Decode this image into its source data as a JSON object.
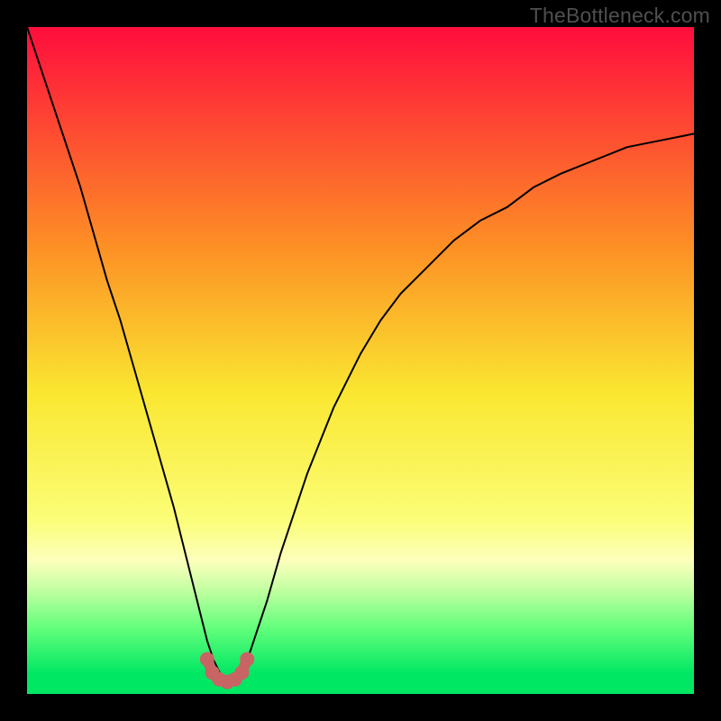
{
  "watermark": "TheBottleneck.com",
  "chart_data": {
    "type": "line",
    "title": "",
    "xlabel": "",
    "ylabel": "",
    "xlim": [
      0,
      100
    ],
    "ylim": [
      0,
      100
    ],
    "background_gradient": {
      "stops": [
        {
          "offset": 0.0,
          "color": "#fe0d3d"
        },
        {
          "offset": 0.33,
          "color": "#fd9025"
        },
        {
          "offset": 0.55,
          "color": "#fae731"
        },
        {
          "offset": 0.74,
          "color": "#fbfe78"
        },
        {
          "offset": 0.8,
          "color": "#fcffbc"
        },
        {
          "offset": 0.84,
          "color": "#c8ffa4"
        },
        {
          "offset": 0.9,
          "color": "#64ff7c"
        },
        {
          "offset": 0.97,
          "color": "#00e763"
        },
        {
          "offset": 1.0,
          "color": "#00e763"
        }
      ]
    },
    "series": [
      {
        "name": "bottleneck-curve",
        "color": "#000000",
        "stroke_width": 2,
        "x": [
          0,
          3,
          5,
          8,
          10,
          12,
          14,
          16,
          18,
          20,
          22,
          24,
          26,
          27,
          28,
          29,
          30,
          31,
          32,
          33,
          34,
          36,
          38,
          40,
          42,
          44,
          46,
          48,
          50,
          53,
          56,
          60,
          64,
          68,
          72,
          76,
          80,
          85,
          90,
          95,
          100
        ],
        "y": [
          100,
          91,
          85,
          76,
          69,
          62,
          56,
          49,
          42,
          35,
          28,
          20,
          12,
          8,
          5,
          3,
          2,
          2,
          3,
          5,
          8,
          14,
          21,
          27,
          33,
          38,
          43,
          47,
          51,
          56,
          60,
          64,
          68,
          71,
          73,
          76,
          78,
          80,
          82,
          83,
          84
        ]
      }
    ],
    "highlight": {
      "name": "valley-marker",
      "color": "#c86464",
      "radius": 8,
      "stroke_width": 12,
      "x": [
        27.0,
        27.8,
        28.8,
        30.0,
        31.2,
        32.2,
        33.0
      ],
      "y": [
        5.2,
        3.2,
        2.2,
        1.8,
        2.2,
        3.2,
        5.2
      ]
    }
  }
}
